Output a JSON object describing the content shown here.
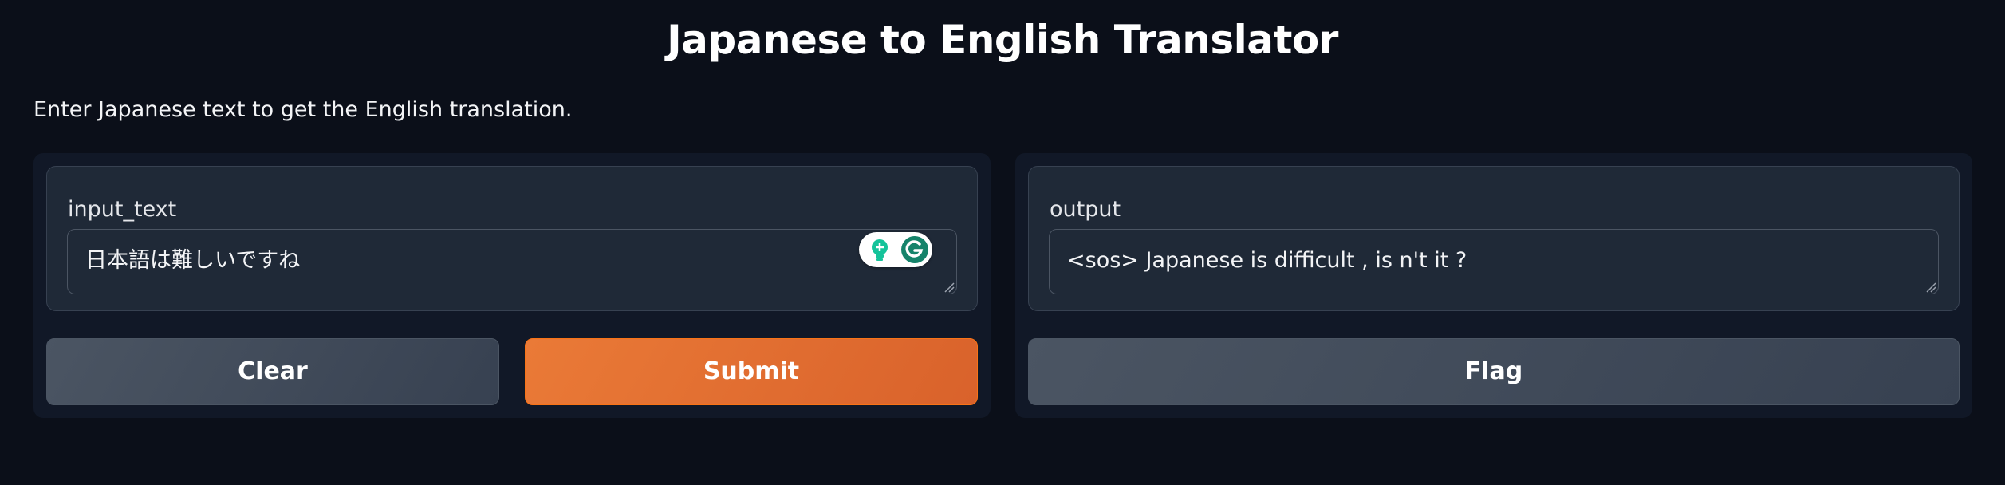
{
  "header": {
    "title": "Japanese to English Translator",
    "description": "Enter Japanese text to get the English translation."
  },
  "input_panel": {
    "label": "input_text",
    "value": "日本語は難しいですね",
    "clear_label": "Clear",
    "submit_label": "Submit",
    "grammarly_icons": [
      "bulb-icon",
      "grammarly-g-icon"
    ]
  },
  "output_panel": {
    "label": "output",
    "value": "<sos> Japanese is difficult , is n't it ?",
    "flag_label": "Flag"
  },
  "colors": {
    "background": "#0b0f19",
    "panel": "#111827",
    "block": "#1f2937",
    "primary_button": "#e8703a",
    "secondary_button": "#4b5563",
    "grammarly_green": "#15c39a"
  }
}
